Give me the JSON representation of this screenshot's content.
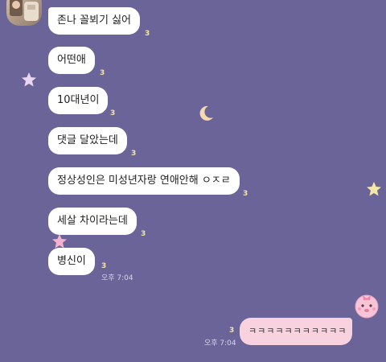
{
  "chat": {
    "received": [
      {
        "text": "존나 꼴뵈기 싫어",
        "unread": "3"
      },
      {
        "text": "어떤애",
        "unread": "3"
      },
      {
        "text": "10대년이",
        "unread": "3"
      },
      {
        "text": "댓글 달았는데",
        "unread": "3"
      },
      {
        "text": "정상성인은 미성년자랑 연애안해 ㅇㅈㄹ",
        "unread": "3"
      },
      {
        "text": "세살 차이라는데",
        "unread": "3"
      },
      {
        "text": "병신이",
        "unread": "3",
        "time": "오후 7:04"
      }
    ],
    "sent": [
      {
        "text": "ㅋㅋㅋㅋㅋㅋㅋㅋㅋㅋㅋ",
        "unread": "3",
        "time": "오후 7:04"
      }
    ]
  },
  "theme": {
    "background": "#6b6499",
    "received_bubble": "#ffffff",
    "sent_bubble": "#f8d3df",
    "unread_color": "#f3e6a3"
  },
  "icons": [
    "profile-photo",
    "star-icon",
    "moon-icon",
    "pink-character-emoticon"
  ]
}
